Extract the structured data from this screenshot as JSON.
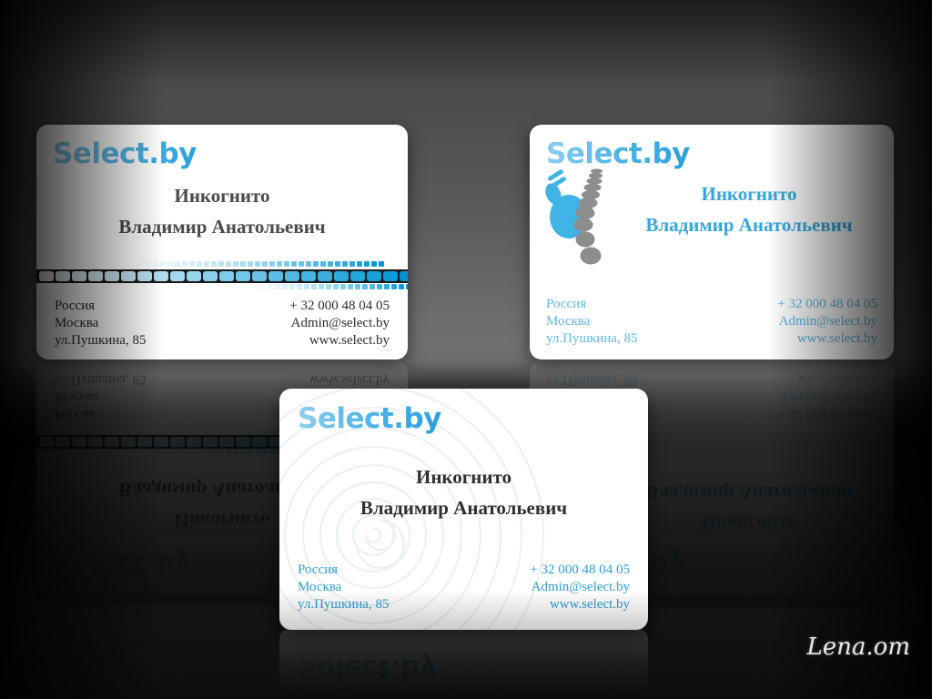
{
  "scene": {
    "background_top_color": "#3e3e3e",
    "background_mid_color": "#707070",
    "background_bottom_color": "#0b0b0b"
  },
  "brand": {
    "wordmark": "Select.by",
    "accent_light": "#8ecdee",
    "accent_mid": "#46b0e4",
    "accent_dark": "#2ba0dd",
    "gray": "#8c8c8c"
  },
  "person": {
    "line1": "Инкогнито",
    "line2": "Владимир Анатольевич"
  },
  "contact": {
    "address": [
      "Россия",
      "Москва",
      "ул.Пушкина, 85"
    ],
    "reach": [
      "+ 32 000 48 04 05",
      "Admin@select.by",
      "www.select.by"
    ]
  },
  "cards": [
    {
      "id": "card-top-left",
      "variant": "striped-band",
      "logo": "Select.by",
      "name_line1": "Инкогнито",
      "name_line2": "Владимир Анатольевич",
      "name_color": "#4a4a4a",
      "contact_color": "#2b2b2b",
      "address": [
        "Россия",
        "Москва",
        "ул.Пушкина, 85"
      ],
      "reach": [
        "+ 32 000 48 04 05",
        "Admin@select.by",
        "www.select.by"
      ]
    },
    {
      "id": "card-top-right",
      "variant": "footprint",
      "logo": "Select.by",
      "name_line1": "Инкогнито",
      "name_line2": "Владимир Анатольевич",
      "name_color": "#37a6dd",
      "contact_color": "#5fb6e3",
      "address": [
        "Россия",
        "Москва",
        "ул.Пушкина, 85"
      ],
      "reach": [
        "+ 32 000 48 04 05",
        "Admin@select.by",
        "www.select.by"
      ]
    },
    {
      "id": "card-bottom-center",
      "variant": "spiral",
      "logo": "Select.by",
      "name_line1": "Инкогнито",
      "name_line2": "Владимир Анатольевич",
      "name_color": "#2f2f2f",
      "contact_color": "#2f9fd8",
      "address": [
        "Россия",
        "Москва",
        "ул.Пушкина, 85"
      ],
      "reach": [
        "+ 32 000 48 04 05",
        "Admin@select.by",
        "www.select.by"
      ]
    }
  ],
  "signature": {
    "text": "Lena.om",
    "color": "#e8e8e8"
  }
}
